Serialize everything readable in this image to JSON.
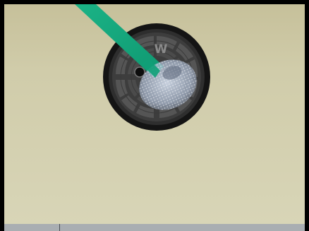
{
  "scene": {
    "cover_letter": "W",
    "colors": {
      "background_top": "#c6c09a",
      "background_bottom": "#d8d5b7",
      "cover_outer": "#141414",
      "cover_plate": "#3d3d3d",
      "cover_tile": "#585858",
      "cover_center": "#0d0d0d",
      "beam": "#14a57a",
      "highlight": "#b9c7dc",
      "status_bar": "#a9aeb2"
    }
  }
}
